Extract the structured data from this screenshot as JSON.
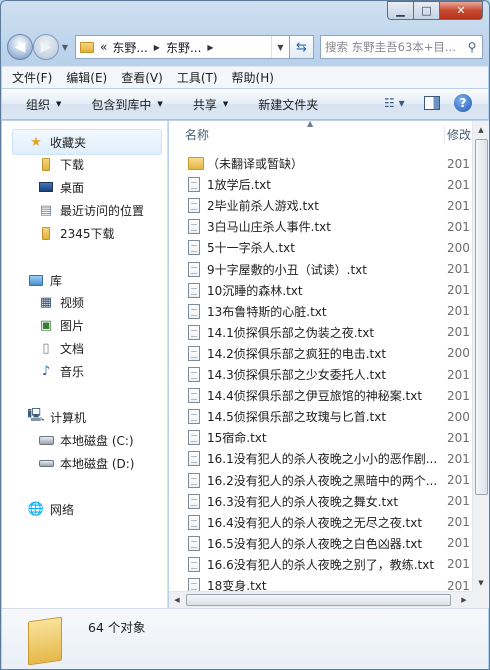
{
  "address": {
    "back_overflow": "«",
    "segments": [
      "东野...",
      "东野..."
    ]
  },
  "search": {
    "placeholder": "搜索 东野圭吾63本+目..."
  },
  "menu": [
    "文件(F)",
    "编辑(E)",
    "查看(V)",
    "工具(T)",
    "帮助(H)"
  ],
  "toolbar": {
    "organize": "组织",
    "include": "包含到库中",
    "share": "共享",
    "new_folder": "新建文件夹"
  },
  "nav": {
    "favorites": "收藏夹",
    "fav_items": [
      "下载",
      "桌面",
      "最近访问的位置",
      "2345下载"
    ],
    "libraries": "库",
    "lib_items": [
      "视频",
      "图片",
      "文档",
      "音乐"
    ],
    "computer": "计算机",
    "drives": [
      "本地磁盘 (C:)",
      "本地磁盘 (D:)"
    ],
    "network": "网络"
  },
  "columns": {
    "name": "名称",
    "modified": "修改"
  },
  "files": [
    {
      "name": "（未翻译或暂缺）",
      "date": "201",
      "type": "folder"
    },
    {
      "name": "1放学后.txt",
      "date": "201",
      "type": "txt"
    },
    {
      "name": "2毕业前杀人游戏.txt",
      "date": "201",
      "type": "txt"
    },
    {
      "name": "3白马山庄杀人事件.txt",
      "date": "201",
      "type": "txt"
    },
    {
      "name": "5十一字杀人.txt",
      "date": "200",
      "type": "txt"
    },
    {
      "name": "9十字屋敷的小丑（试读）.txt",
      "date": "201",
      "type": "txt"
    },
    {
      "name": "10沉睡的森林.txt",
      "date": "201",
      "type": "txt"
    },
    {
      "name": "13布鲁特斯的心脏.txt",
      "date": "201",
      "type": "txt"
    },
    {
      "name": "14.1侦探俱乐部之伪装之夜.txt",
      "date": "201",
      "type": "txt"
    },
    {
      "name": "14.2侦探俱乐部之疯狂的电击.txt",
      "date": "200",
      "type": "txt"
    },
    {
      "name": "14.3侦探俱乐部之少女委托人.txt",
      "date": "201",
      "type": "txt"
    },
    {
      "name": "14.4侦探俱乐部之伊豆旅馆的神秘案.txt",
      "date": "201",
      "type": "txt"
    },
    {
      "name": "14.5侦探俱乐部之玫瑰与匕首.txt",
      "date": "200",
      "type": "txt"
    },
    {
      "name": "15宿命.txt",
      "date": "201",
      "type": "txt"
    },
    {
      "name": "16.1没有犯人的杀人夜晚之小小的恶作剧...",
      "date": "201",
      "type": "txt"
    },
    {
      "name": "16.2没有犯人的杀人夜晚之黑暗中的两个...",
      "date": "201",
      "type": "txt"
    },
    {
      "name": "16.3没有犯人的杀人夜晚之舞女.txt",
      "date": "201",
      "type": "txt"
    },
    {
      "name": "16.4没有犯人的杀人夜晚之无尽之夜.txt",
      "date": "201",
      "type": "txt"
    },
    {
      "name": "16.5没有犯人的杀人夜晚之白色凶器.txt",
      "date": "201",
      "type": "txt"
    },
    {
      "name": "16.6没有犯人的杀人夜晚之别了，教练.txt",
      "date": "201",
      "type": "txt"
    },
    {
      "name": "18变身.txt",
      "date": "201",
      "type": "txt"
    }
  ],
  "status": {
    "count": "64 个对象"
  },
  "colors": {
    "folder": "#e4b644",
    "selection": "#dfeefc",
    "accent": "#1d58b0"
  }
}
